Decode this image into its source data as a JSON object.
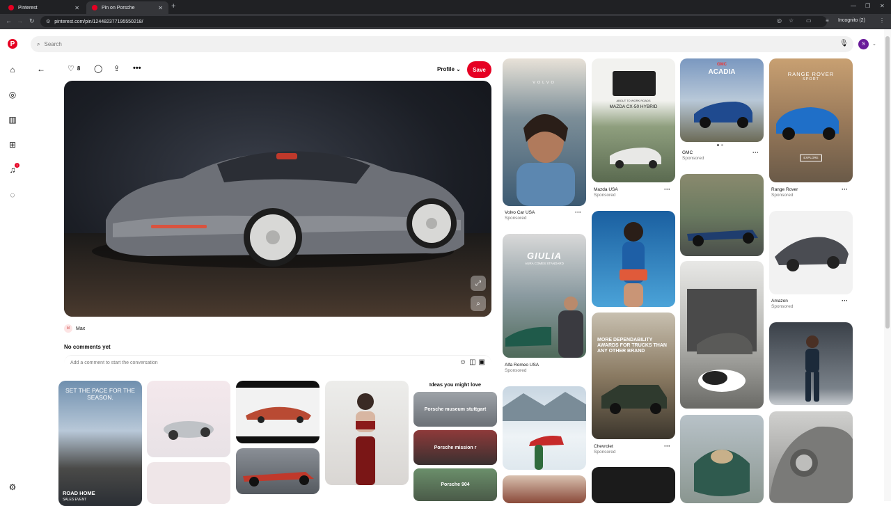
{
  "browser": {
    "tabs": [
      {
        "title": "Pinterest"
      },
      {
        "title": "Pin on Porsche"
      }
    ],
    "url": "pinterest.com/pin/1244823771955502​18/",
    "profile_label": "Incognito (2)"
  },
  "search": {
    "placeholder": "Search"
  },
  "user": {
    "initial": "S"
  },
  "rail": {
    "notification_count": "1"
  },
  "pin": {
    "like_count": "8",
    "profile_label": "Profile",
    "save_label": "Save",
    "author_initial": "M",
    "author_name": "Max",
    "no_comments": "No comments yet",
    "comment_placeholder": "Add a comment to start the conversation"
  },
  "ideas": {
    "title": "Ideas you might love",
    "items": [
      "Porsche museum stuttgart",
      "Porsche mission r",
      "Porsche 904"
    ]
  },
  "pins": {
    "bmw_headline": "SET THE PACE FOR THE SEASON.",
    "bmw_footer": "ROAD HOME",
    "bmw_sub": "SALES EVENT",
    "volvo_brand": "VOLVO",
    "volvo_name": "Volvo Car USA",
    "mazda_head": "ABOUT TO WORK ROADS",
    "mazda_model": "MAZDA CX-50 HYBRID",
    "mazda_name": "Mazda USA",
    "gmc_brand": "GMC",
    "gmc_model": "ACADIA",
    "gmc_name": "GMC",
    "rr_brand": "RANGE ROVER",
    "rr_sub": "SPORT",
    "rr_cta": "EXPLORE",
    "rr_name": "Range Rover",
    "giulia_title": "GIULIA",
    "giulia_sub": "AURA COMES STANDARD",
    "alfa_name": "Alfa Romeo USA",
    "chevy_text": "MORE DEPENDABILITY AWARDS FOR TRUCKS THAN ANY OTHER BRAND",
    "chevy_name": "Chevrolet",
    "amazon_name": "Amazon",
    "sponsored": "Sponsored"
  }
}
